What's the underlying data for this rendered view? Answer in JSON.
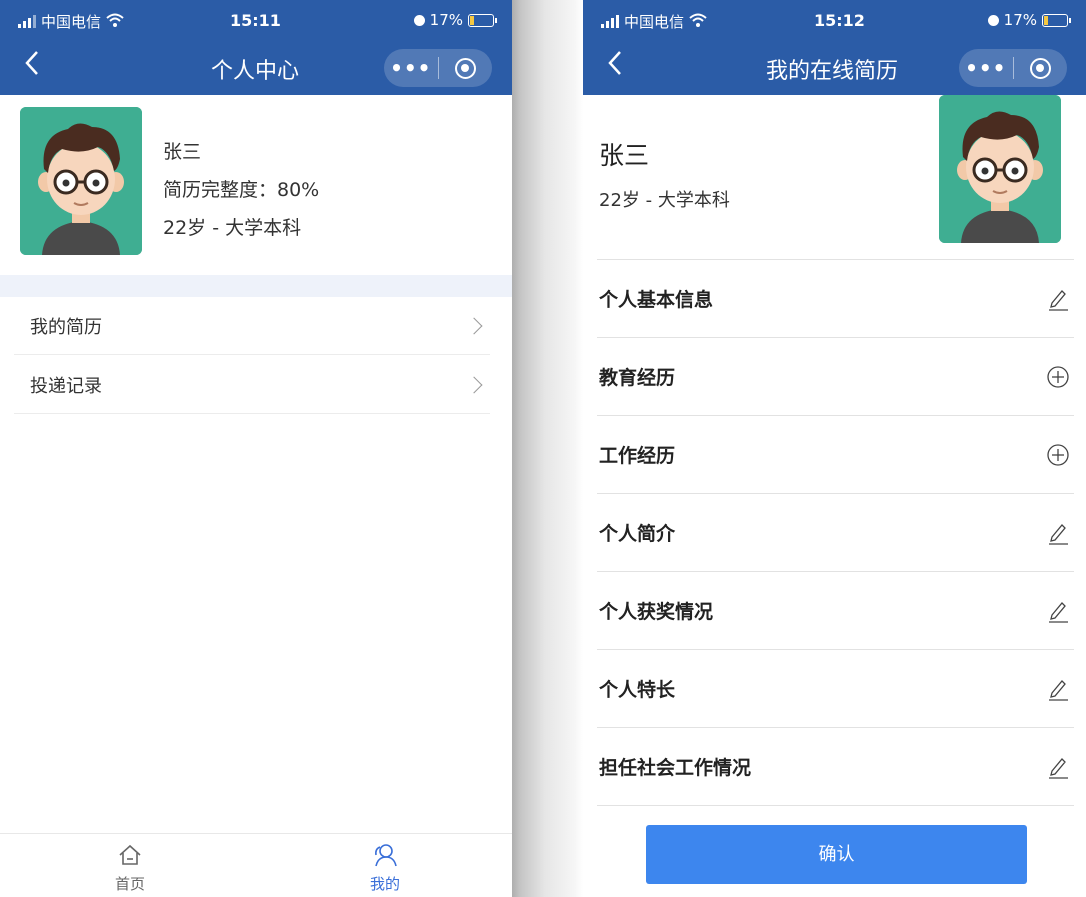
{
  "left_screen": {
    "status_bar": {
      "carrier": "中国电信",
      "time": "15:11",
      "battery": "17%",
      "battery_level": 0.17
    },
    "nav": {
      "title": "个人中心",
      "back_icon": "chevron-left-icon",
      "more_label": "•••"
    },
    "profile": {
      "name": "张三",
      "completeness": "简历完整度：80%",
      "age_education": "22岁 - 大学本科"
    },
    "menu": [
      {
        "label": "我的简历"
      },
      {
        "label": "投递记录"
      }
    ],
    "tabbar": [
      {
        "label": "首页",
        "icon": "home-icon",
        "active": false
      },
      {
        "label": "我的",
        "icon": "user-icon",
        "active": true
      }
    ]
  },
  "right_screen": {
    "status_bar": {
      "carrier": "中国电信",
      "time": "15:12",
      "battery": "17%",
      "battery_level": 0.17
    },
    "nav": {
      "title": "我的在线简历",
      "back_icon": "chevron-left-icon",
      "more_label": "•••"
    },
    "profile": {
      "name": "张三",
      "age_education": "22岁 - 大学本科"
    },
    "sections": [
      {
        "label": "个人基本信息",
        "icon": "edit-icon"
      },
      {
        "label": "教育经历",
        "icon": "add-icon"
      },
      {
        "label": "工作经历",
        "icon": "add-icon"
      },
      {
        "label": "个人简介",
        "icon": "edit-icon"
      },
      {
        "label": "个人获奖情况",
        "icon": "edit-icon"
      },
      {
        "label": "个人特长",
        "icon": "edit-icon"
      },
      {
        "label": "担任社会工作情况",
        "icon": "edit-icon"
      }
    ],
    "confirm_label": "确认"
  },
  "colors": {
    "header_blue": "#2b5ca7",
    "button_blue": "#3d86ee",
    "tab_active": "#3a6fd8",
    "tab_inactive": "#666666",
    "avatar_bg": "#3fae92"
  }
}
